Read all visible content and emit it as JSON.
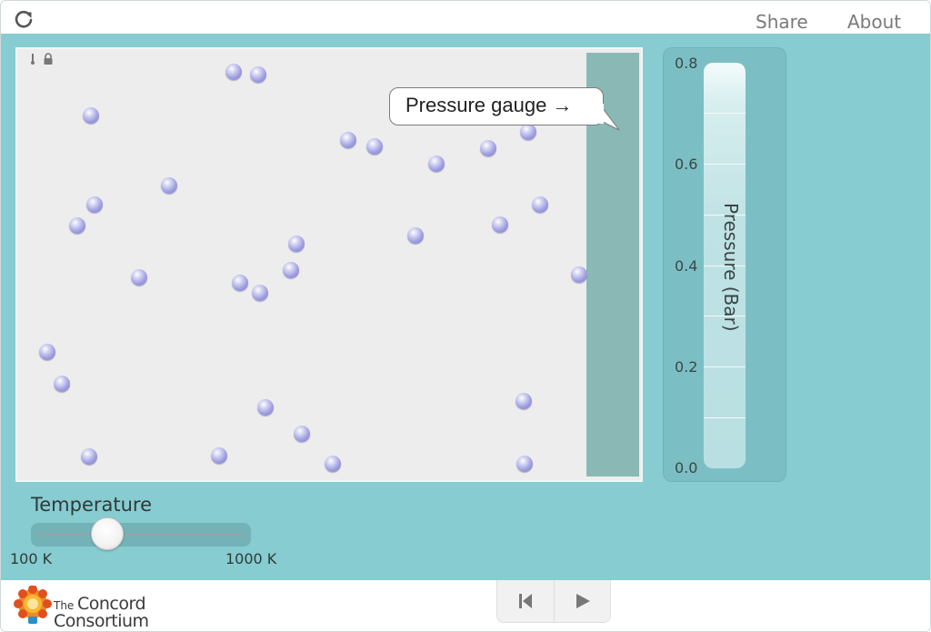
{
  "topbar": {
    "reload_icon": "reload-icon",
    "share_label": "Share",
    "about_label": "About"
  },
  "simulation": {
    "background_color": "#86ccd0",
    "container_color": "#ededed",
    "wall_color": "#8ab9b5",
    "particle_count": 31,
    "annotation_text": "Pressure gauge →"
  },
  "gauge": {
    "title": "Pressure (Bar)",
    "ticks": [
      "0.8",
      "0.6",
      "0.4",
      "0.2",
      "0.0"
    ]
  },
  "temperature": {
    "label": "Temperature",
    "min_label": "100 K",
    "max_label": "1000 K"
  },
  "footer": {
    "logo_small": "The",
    "logo_line1": "Concord",
    "logo_line2": "Consortium",
    "reset_icon": "skip-back-icon",
    "play_icon": "play-icon"
  }
}
